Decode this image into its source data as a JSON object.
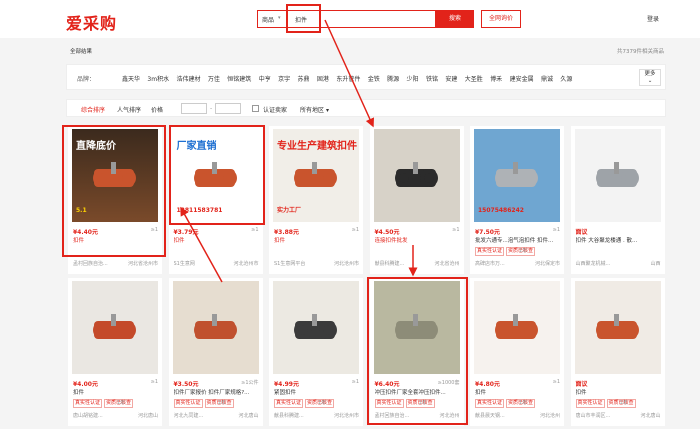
{
  "header": {
    "logo": "爱采购",
    "search_type": "商品",
    "search_value": "扣件",
    "search_button": "搜索",
    "global_button": "全网询价",
    "login": "登录"
  },
  "crumb": "全部结果",
  "result_count": "共7379件相关商品",
  "brands": {
    "label": "品牌：",
    "items": [
      "鑫天华",
      "3m积水",
      "浩伟建材",
      "万佳",
      "恒铭建筑",
      "中亨",
      "京宇",
      "苏鼎",
      "固港",
      "东升管件",
      "金铁",
      "腾源",
      "少阳",
      "铁铭",
      "安建",
      "大圣胜",
      "博禾",
      "建安金属",
      "鼎诚",
      "久源"
    ],
    "more": "更多"
  },
  "filters": {
    "sort_default": "综合排序",
    "sort_popular": "人气排序",
    "price_label": "价格",
    "price_sep": "-",
    "certified": "认证卖家",
    "region": "所有地区"
  },
  "products": [
    {
      "price": "¥4.40元",
      "qty": "≥1",
      "title": "扣件",
      "highlight": "",
      "tags": [],
      "shop": "孟村回族自治...",
      "loc": "河北省沧州市",
      "year": "",
      "img_text": "直降底价",
      "img_sub": "5.1"
    },
    {
      "price": "¥3.79元",
      "qty": "≥1",
      "title": "扣件",
      "highlight": "",
      "tags": [],
      "shop": "S1生意网",
      "loc": "河北沧州市",
      "year": "",
      "img_text": "厂家直销",
      "img_sub": "13811583781"
    },
    {
      "price": "¥3.88元",
      "qty": "≥1",
      "title": "扣件",
      "highlight": "",
      "tags": [],
      "shop": "S1生意网平台",
      "loc": "河北沧州市",
      "year": "",
      "img_text": "专业生产建筑扣件",
      "img_sub": "实力工厂"
    },
    {
      "price": "¥4.50元",
      "qty": "≥1",
      "title": "连接扣件批发",
      "highlight": "扣件",
      "tags": [],
      "shop": "献县科腾建...",
      "loc": "河北省沧州",
      "year": "",
      "img_text": "",
      "img_sub": ""
    },
    {
      "price": "¥7.50元",
      "qty": "≥1",
      "title": "批发六通专...泡气泡扣件 扣件...",
      "highlight": "",
      "tags": [
        "真实性认证",
        "资质已核查"
      ],
      "shop": "高碑店市万...",
      "loc": "河北保定市",
      "year": "1年",
      "img_text": "",
      "img_sub": "15075486242"
    },
    {
      "price": "面议",
      "qty": "",
      "title": "扣件 大谷聚龙楼通 . 散...",
      "highlight": "",
      "tags": [],
      "shop": "山西聚龙机械...",
      "loc": "山西",
      "year": "",
      "img_text": "",
      "img_sub": ""
    },
    {
      "price": "¥4.00元",
      "qty": "≥1",
      "title": "扣件",
      "highlight": "",
      "tags": [
        "真实性认证",
        "资质已核查"
      ],
      "shop": "唐山胡铭建...",
      "loc": "河北唐山",
      "year": "1年",
      "img_text": "",
      "img_sub": ""
    },
    {
      "price": "¥3.50元",
      "qty": "≥1公件",
      "title": "扣件厂家报价 扣件厂家规格?...",
      "highlight": "",
      "tags": [
        "真实性认证",
        "资质已核查"
      ],
      "shop": "河北九同建...",
      "loc": "河北唐山",
      "year": "1年",
      "img_text": "",
      "img_sub": ""
    },
    {
      "price": "¥4.99元",
      "qty": "≥1",
      "title": "紧固扣件",
      "highlight": "",
      "tags": [
        "真实性认证",
        "资质已核查"
      ],
      "shop": "献县科腾建...",
      "loc": "河北沧州市",
      "year": "1年",
      "img_text": "",
      "img_sub": ""
    },
    {
      "price": "¥6.40元",
      "qty": "≥1000套",
      "title": "冲压扣件厂家全套冲压扣件...",
      "highlight": "",
      "tags": [
        "真实性认证",
        "资质已核查"
      ],
      "shop": "孟村回族自治...",
      "loc": "河北沧州",
      "year": "1年",
      "img_text": "",
      "img_sub": ""
    },
    {
      "price": "¥4.80元",
      "qty": "≥1",
      "title": "扣件",
      "highlight": "",
      "tags": [
        "真实性认证",
        "资质已核查"
      ],
      "shop": "献县晨天钢...",
      "loc": "河北沧州",
      "year": "1年",
      "img_text": "",
      "img_sub": ""
    },
    {
      "price": "面议",
      "qty": "",
      "title": "扣件",
      "highlight": "",
      "tags": [
        "真实性认证",
        "资质已核查"
      ],
      "shop": "唐山市丰润区...",
      "loc": "河北唐山",
      "year": "1年",
      "img_text": "",
      "img_sub": ""
    }
  ],
  "colors": {
    "brand_red": "#e2231a",
    "annotation_red": "#e2231a"
  }
}
